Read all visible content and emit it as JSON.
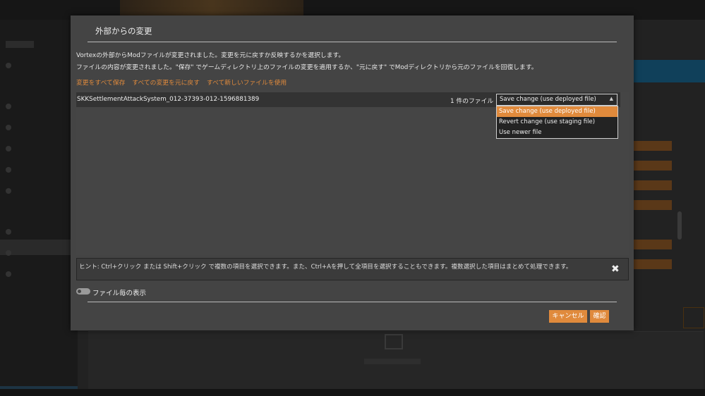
{
  "dialog": {
    "title": "外部からの変更",
    "description_line1": "Vortexの外部からModファイルが変更されました。変更を元に戻すか反映するかを選択します。",
    "description_line2": "ファイルの内容が変更されました。\"保存\" でゲームディレクトリ上のファイルの変更を適用するか、\"元に戻す\" でModディレクトリから元のファイルを回復します。",
    "bulk_actions": {
      "save_all": "変更をすべて保存",
      "revert_all": "すべての変更を元に戻す",
      "use_newer_all": "すべて新しいファイルを使用"
    },
    "rows": [
      {
        "name": "SKKSettlementAttackSystem_012-37393-012-1596881389",
        "count": "1 件のファイル",
        "selected": "Save change (use deployed file)"
      }
    ],
    "dropdown_options": [
      "Save change (use deployed file)",
      "Revert change (use staging file)",
      "Use newer file"
    ],
    "hint": "ヒント: Ctrl+クリック または Shift+クリック で複数の項目を選択できます。また、Ctrl+Aを押して全項目を選択することもできます。複数選択した項目はまとめて処理できます。",
    "hint_close": "✖",
    "toggle_label": "ファイル毎の表示",
    "cancel_label": "キャンセル",
    "confirm_label": "確認"
  },
  "colors": {
    "accent": "#e08a3c",
    "dialog_bg": "#444444",
    "row_bg": "#333333"
  }
}
